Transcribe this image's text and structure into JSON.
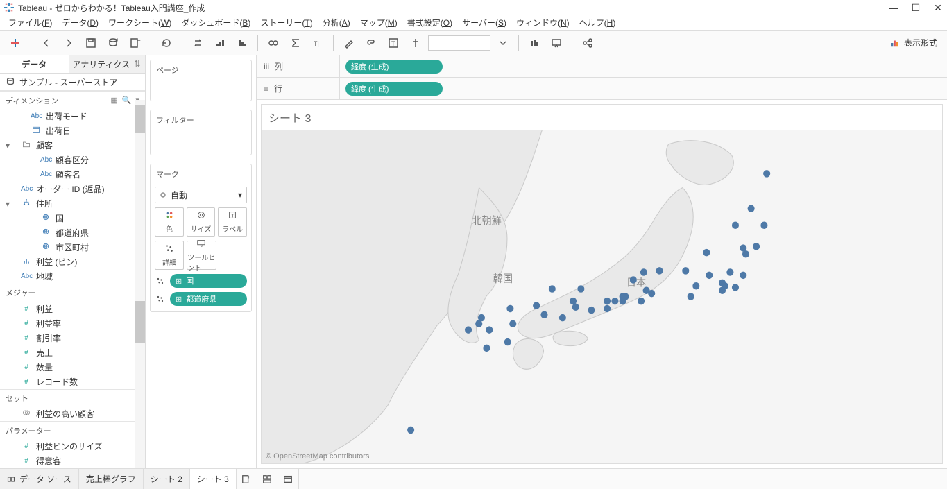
{
  "titlebar": {
    "app": "Tableau",
    "doc": "ゼロからわかる！Tableau入門講座_作成"
  },
  "menu": [
    "ファイル(F)",
    "データ(D)",
    "ワークシート(W)",
    "ダッシュボード(B)",
    "ストーリー(T)",
    "分析(A)",
    "マップ(M)",
    "書式設定(O)",
    "サーバー(S)",
    "ウィンドウ(N)",
    "ヘルプ(H)"
  ],
  "toolbar": {
    "showme": "表示形式"
  },
  "side": {
    "tabs": {
      "data": "データ",
      "analytics": "アナリティクス"
    },
    "datasource": "サンプル - スーパーストア",
    "dimensions_label": "ディメンション",
    "dim_fields": [
      {
        "icon": "Abc",
        "label": "出荷モード",
        "indent": 1
      },
      {
        "icon": "date",
        "label": "出荷日",
        "indent": 1
      },
      {
        "icon": "folder",
        "label": "顧客",
        "indent": 0,
        "caret": true
      },
      {
        "icon": "Abc",
        "label": "顧客区分",
        "indent": 2
      },
      {
        "icon": "Abc",
        "label": "顧客名",
        "indent": 2
      },
      {
        "icon": "Abc",
        "label": "オーダー ID (返品)",
        "indent": 0
      },
      {
        "icon": "hier",
        "label": "住所",
        "indent": 0,
        "caret": true
      },
      {
        "icon": "globe",
        "label": "国",
        "indent": 2
      },
      {
        "icon": "globe",
        "label": "都道府県",
        "indent": 2
      },
      {
        "icon": "globe",
        "label": "市区町村",
        "indent": 2
      },
      {
        "icon": "bar",
        "label": "利益 (ビン)",
        "indent": 0
      },
      {
        "icon": "Abc",
        "label": "地域",
        "indent": 0
      }
    ],
    "measures_label": "メジャー",
    "mea_fields": [
      {
        "icon": "#",
        "label": "利益"
      },
      {
        "icon": "#",
        "label": "利益率"
      },
      {
        "icon": "#",
        "label": "割引率"
      },
      {
        "icon": "#",
        "label": "売上"
      },
      {
        "icon": "#",
        "label": "数量"
      },
      {
        "icon": "#",
        "label": "レコード数"
      }
    ],
    "sets_label": "セット",
    "sets": [
      {
        "icon": "set",
        "label": "利益の高い顧客"
      }
    ],
    "params_label": "パラメーター",
    "params": [
      {
        "icon": "#",
        "label": "利益ビンのサイズ"
      },
      {
        "icon": "#",
        "label": "得意客"
      }
    ]
  },
  "mid": {
    "pages": "ページ",
    "filters": "フィルター",
    "marks": "マーク",
    "marktype": "自動",
    "cells_row1": [
      {
        "label": "色",
        "icon": "palette"
      },
      {
        "label": "サイズ",
        "icon": "size"
      },
      {
        "label": "ラベル",
        "icon": "label"
      }
    ],
    "cells_row2": [
      {
        "label": "詳細",
        "icon": "detail"
      },
      {
        "label": "ツールヒント",
        "icon": "tooltip"
      }
    ],
    "pills": [
      {
        "icon": "detail",
        "label": "国"
      },
      {
        "icon": "detail",
        "label": "都道府県"
      }
    ]
  },
  "shelves": {
    "columns_label": "列",
    "columns_pill": "経度 (生成)",
    "rows_label": "行",
    "rows_pill": "緯度 (生成)"
  },
  "viz": {
    "title": "シート 3",
    "attrib": "© OpenStreetMap contributors",
    "labels": {
      "nk": "北朝鮮",
      "kr": "韓国",
      "jp": "日本"
    }
  },
  "bottom": {
    "datasource": "データ ソース",
    "tabs": [
      "売上棒グラフ",
      "シート 2",
      "シート 3"
    ]
  },
  "chart_data": {
    "type": "scatter",
    "title": "シート 3",
    "xlabel": "経度 (生成)",
    "ylabel": "緯度 (生成)",
    "series": [
      {
        "name": "都道府県",
        "points": [
          {
            "x": 141.3,
            "y": 43.1
          },
          {
            "x": 140.7,
            "y": 40.8
          },
          {
            "x": 141.2,
            "y": 39.7
          },
          {
            "x": 140.9,
            "y": 38.3
          },
          {
            "x": 140.1,
            "y": 39.7
          },
          {
            "x": 140.4,
            "y": 38.2
          },
          {
            "x": 140.5,
            "y": 37.8
          },
          {
            "x": 140.4,
            "y": 36.4
          },
          {
            "x": 139.9,
            "y": 36.6
          },
          {
            "x": 139.1,
            "y": 36.4
          },
          {
            "x": 139.6,
            "y": 35.9
          },
          {
            "x": 140.1,
            "y": 35.6
          },
          {
            "x": 139.7,
            "y": 35.7
          },
          {
            "x": 139.6,
            "y": 35.4
          },
          {
            "x": 139.0,
            "y": 37.9
          },
          {
            "x": 137.2,
            "y": 36.7
          },
          {
            "x": 136.6,
            "y": 36.6
          },
          {
            "x": 136.2,
            "y": 36.1
          },
          {
            "x": 138.6,
            "y": 35.7
          },
          {
            "x": 138.2,
            "y": 36.7
          },
          {
            "x": 136.7,
            "y": 35.4
          },
          {
            "x": 138.4,
            "y": 35.0
          },
          {
            "x": 136.9,
            "y": 35.2
          },
          {
            "x": 136.5,
            "y": 34.7
          },
          {
            "x": 135.9,
            "y": 35.0
          },
          {
            "x": 135.8,
            "y": 35.0
          },
          {
            "x": 135.5,
            "y": 34.7
          },
          {
            "x": 135.2,
            "y": 34.7
          },
          {
            "x": 135.8,
            "y": 34.7
          },
          {
            "x": 135.2,
            "y": 34.2
          },
          {
            "x": 134.2,
            "y": 35.5
          },
          {
            "x": 133.1,
            "y": 35.5
          },
          {
            "x": 133.9,
            "y": 34.7
          },
          {
            "x": 132.5,
            "y": 34.4
          },
          {
            "x": 131.5,
            "y": 34.2
          },
          {
            "x": 134.6,
            "y": 34.1
          },
          {
            "x": 134.0,
            "y": 34.3
          },
          {
            "x": 132.8,
            "y": 33.8
          },
          {
            "x": 133.5,
            "y": 33.6
          },
          {
            "x": 130.4,
            "y": 33.6
          },
          {
            "x": 130.3,
            "y": 33.2
          },
          {
            "x": 129.9,
            "y": 32.8
          },
          {
            "x": 130.7,
            "y": 32.8
          },
          {
            "x": 131.6,
            "y": 33.2
          },
          {
            "x": 131.4,
            "y": 32.0
          },
          {
            "x": 130.6,
            "y": 31.6
          },
          {
            "x": 127.7,
            "y": 26.2
          }
        ]
      }
    ],
    "xlim": [
      122,
      148
    ],
    "ylim": [
      24,
      46
    ]
  }
}
